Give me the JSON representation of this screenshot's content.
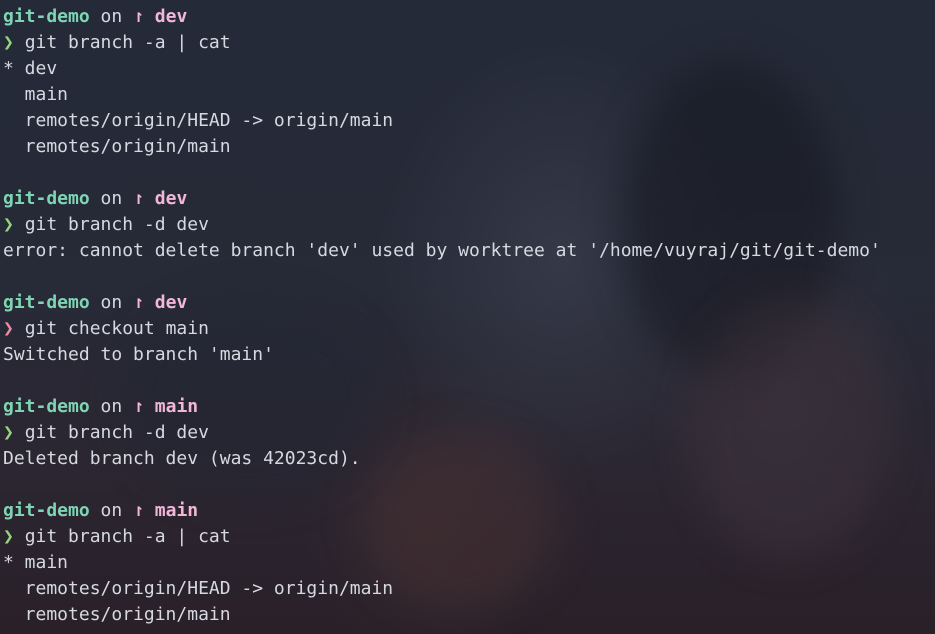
{
  "blocks": [
    {
      "repo": "git-demo",
      "on": "on",
      "branch_icon": "↾",
      "branch": "dev",
      "prompt_symbol": "❯",
      "prompt_status": "success",
      "command": "git branch -a | cat",
      "output": [
        "* dev",
        "  main",
        "  remotes/origin/HEAD -> origin/main",
        "  remotes/origin/main"
      ]
    },
    {
      "repo": "git-demo",
      "on": "on",
      "branch_icon": "↾",
      "branch": "dev",
      "prompt_symbol": "❯",
      "prompt_status": "success",
      "command": "git branch -d dev",
      "output": [
        "error: cannot delete branch 'dev' used by worktree at '/home/vuyraj/git/git-demo'"
      ]
    },
    {
      "repo": "git-demo",
      "on": "on",
      "branch_icon": "↾",
      "branch": "dev",
      "prompt_symbol": "❯",
      "prompt_status": "error",
      "command": "git checkout main",
      "output": [
        "Switched to branch 'main'"
      ]
    },
    {
      "repo": "git-demo",
      "on": "on",
      "branch_icon": "↾",
      "branch": "main",
      "prompt_symbol": "❯",
      "prompt_status": "success",
      "command": "git branch -d dev",
      "output": [
        "Deleted branch dev (was 42023cd)."
      ]
    },
    {
      "repo": "git-demo",
      "on": "on",
      "branch_icon": "↾",
      "branch": "main",
      "prompt_symbol": "❯",
      "prompt_status": "success",
      "command": "git branch -a | cat",
      "output": [
        "* main",
        "  remotes/origin/HEAD -> origin/main",
        "  remotes/origin/main"
      ]
    }
  ],
  "colors": {
    "repo": "#7fd4b4",
    "branch": "#f2b6d8",
    "prompt_success": "#95d47c",
    "prompt_error": "#f08aa0",
    "text": "#d6d9e0"
  }
}
